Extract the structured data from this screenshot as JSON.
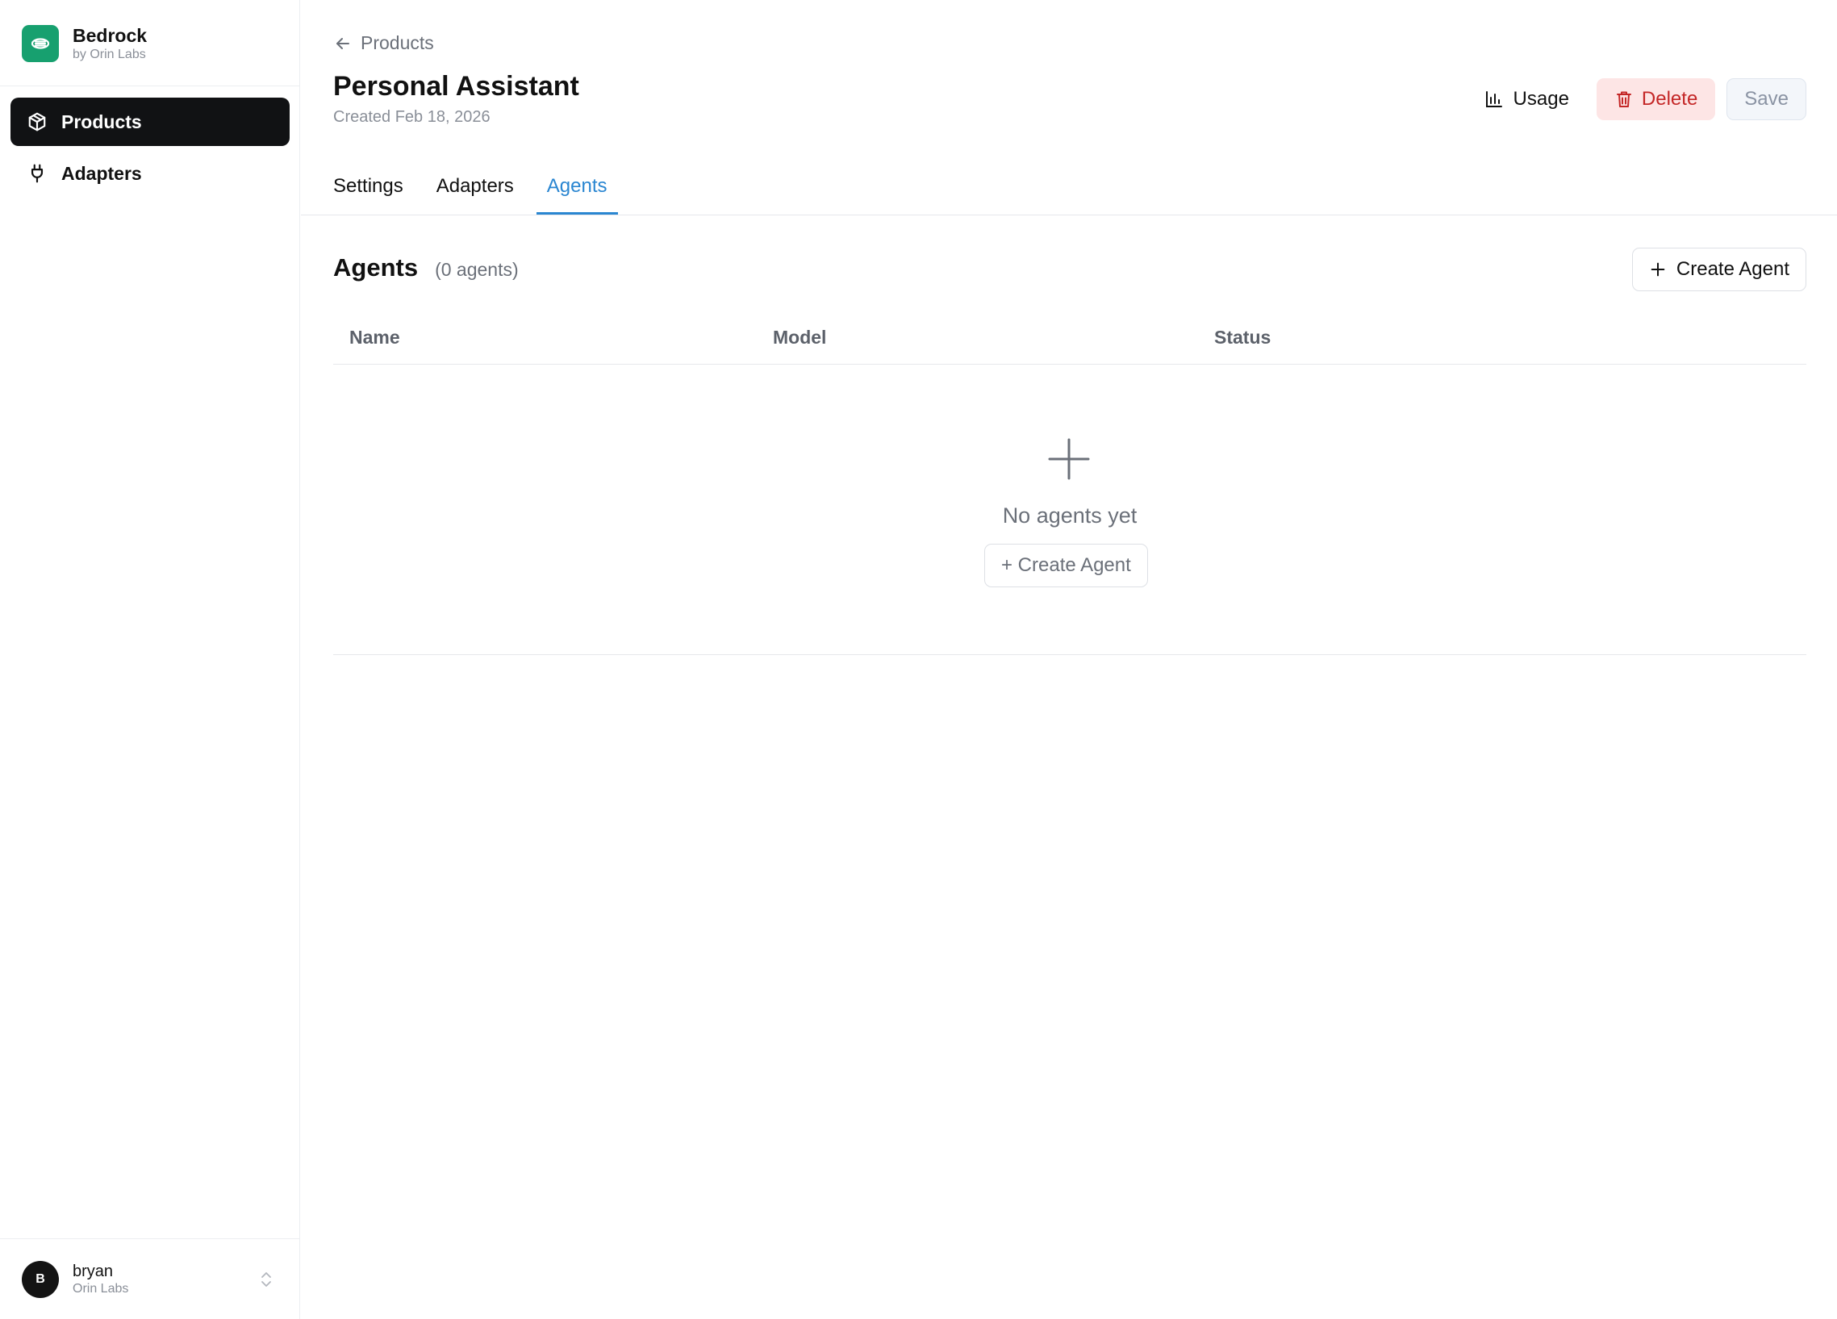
{
  "brand": {
    "name": "Bedrock",
    "subtitle": "by Orin Labs",
    "icon": "link-icon",
    "color": "#17a06f"
  },
  "sidebar": {
    "items": [
      {
        "label": "Products",
        "icon": "package-icon",
        "active": true
      },
      {
        "label": "Adapters",
        "icon": "plug-icon",
        "active": false
      }
    ]
  },
  "user": {
    "initial": "B",
    "name": "bryan",
    "org": "Orin Labs"
  },
  "header": {
    "back_label": "Products",
    "title": "Personal Assistant",
    "created": "Created Feb 18, 2026",
    "usage_label": "Usage",
    "delete_label": "Delete",
    "save_label": "Save"
  },
  "tabs": [
    {
      "label": "Settings",
      "active": false
    },
    {
      "label": "Adapters",
      "active": false
    },
    {
      "label": "Agents",
      "active": true
    }
  ],
  "agents": {
    "title": "Agents",
    "count_label": "(0 agents)",
    "create_label": "Create Agent",
    "columns": [
      "Name",
      "Model",
      "Status"
    ],
    "rows": [],
    "empty_text": "No agents yet",
    "empty_create_label": "+ Create Agent"
  },
  "colors": {
    "accent": "#2a86d1",
    "danger": "#c42626",
    "danger_bg": "#fde5e5"
  }
}
